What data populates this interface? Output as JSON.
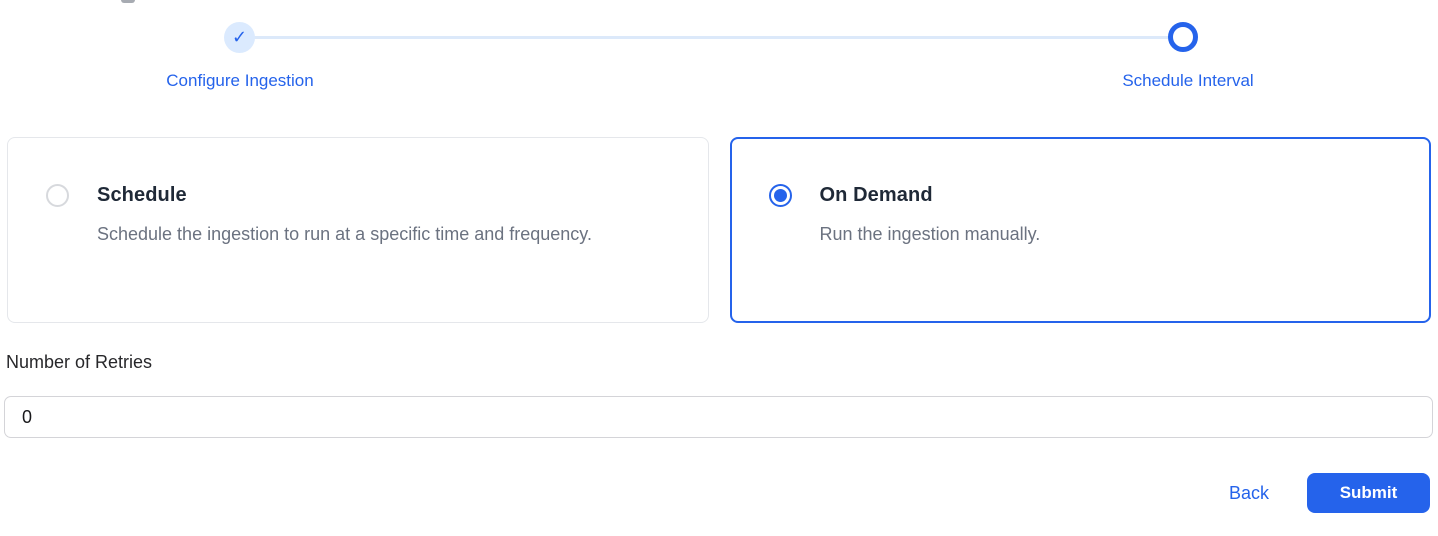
{
  "stepper": {
    "check_icon": "✓",
    "steps": [
      {
        "label": "Configure Ingestion",
        "state": "completed"
      },
      {
        "label": "Schedule Interval",
        "state": "active"
      }
    ]
  },
  "options": [
    {
      "title": "Schedule",
      "description": "Schedule the ingestion to run at a specific time and frequency.",
      "selected": false
    },
    {
      "title": "On Demand",
      "description": "Run the ingestion manually.",
      "selected": true
    }
  ],
  "retries": {
    "label": "Number of Retries",
    "value": "0"
  },
  "footer": {
    "back_label": "Back",
    "submit_label": "Submit"
  },
  "colors": {
    "accent": "#2563eb",
    "accent_light": "#dbeafe",
    "stepper_line": "#dce9fa",
    "card_border": "#e5e7eb",
    "selected_border": "#2563eb",
    "title_text": "#1f2937",
    "description_text": "#6b7280",
    "input_border": "#d4d4d8"
  }
}
